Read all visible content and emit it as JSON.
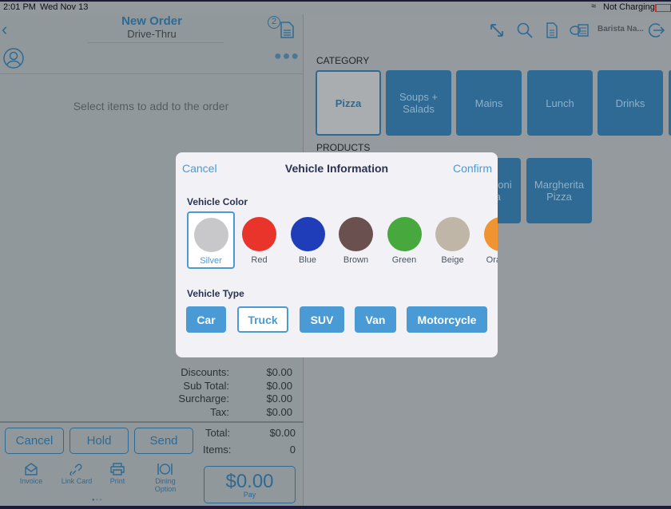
{
  "status_bar": {
    "time": "2:01 PM",
    "date": "Wed Nov 13",
    "battery": "Not Charging"
  },
  "order": {
    "title": "New Order",
    "subtitle": "Drive-Thru",
    "badge_count": "2",
    "empty_message": "Select items to add to the order"
  },
  "totals": {
    "rows": [
      {
        "label": "Discounts:",
        "value": "$0.00"
      },
      {
        "label": "Sub Total:",
        "value": "$0.00"
      },
      {
        "label": "Surcharge:",
        "value": "$0.00"
      },
      {
        "label": "Tax:",
        "value": "$0.00"
      }
    ],
    "total_label": "Total:",
    "total_value": "$0.00",
    "items_label": "Items:",
    "items_value": "0"
  },
  "buttons": {
    "cancel": "Cancel",
    "hold": "Hold",
    "send": "Send",
    "pay_amount": "$0.00",
    "pay_label": "Pay"
  },
  "actions": [
    {
      "label": "Invoice",
      "icon": "envelope-icon"
    },
    {
      "label": "Link Card",
      "icon": "link-icon"
    },
    {
      "label": "Print",
      "icon": "printer-icon"
    },
    {
      "label": "Dining Option",
      "icon": "dining-icon"
    }
  ],
  "header": {
    "user": "Barista Na..."
  },
  "category": {
    "label": "CATEGORY",
    "items": [
      "Pizza",
      "Soups + Salads",
      "Mains",
      "Lunch",
      "Drinks"
    ],
    "selected": "Pizza"
  },
  "products": {
    "label": "PRODUCTS",
    "items": [
      "Pepperoni Pizza",
      "Margherita Pizza"
    ]
  },
  "modal": {
    "title": "Vehicle Information",
    "cancel": "Cancel",
    "confirm": "Confirm",
    "color_label": "Vehicle Color",
    "colors": [
      {
        "name": "Silver",
        "hex": "#c8c8ca"
      },
      {
        "name": "Red",
        "hex": "#e8342a"
      },
      {
        "name": "Blue",
        "hex": "#1f3db8"
      },
      {
        "name": "Brown",
        "hex": "#6b5050"
      },
      {
        "name": "Green",
        "hex": "#47a83d"
      },
      {
        "name": "Beige",
        "hex": "#bfb6a8"
      },
      {
        "name": "Orange",
        "hex": "#ef9430"
      }
    ],
    "selected_color": "Silver",
    "type_label": "Vehicle Type",
    "types": [
      "Car",
      "Truck",
      "SUV",
      "Van",
      "Motorcycle"
    ],
    "selected_type": "Truck"
  }
}
